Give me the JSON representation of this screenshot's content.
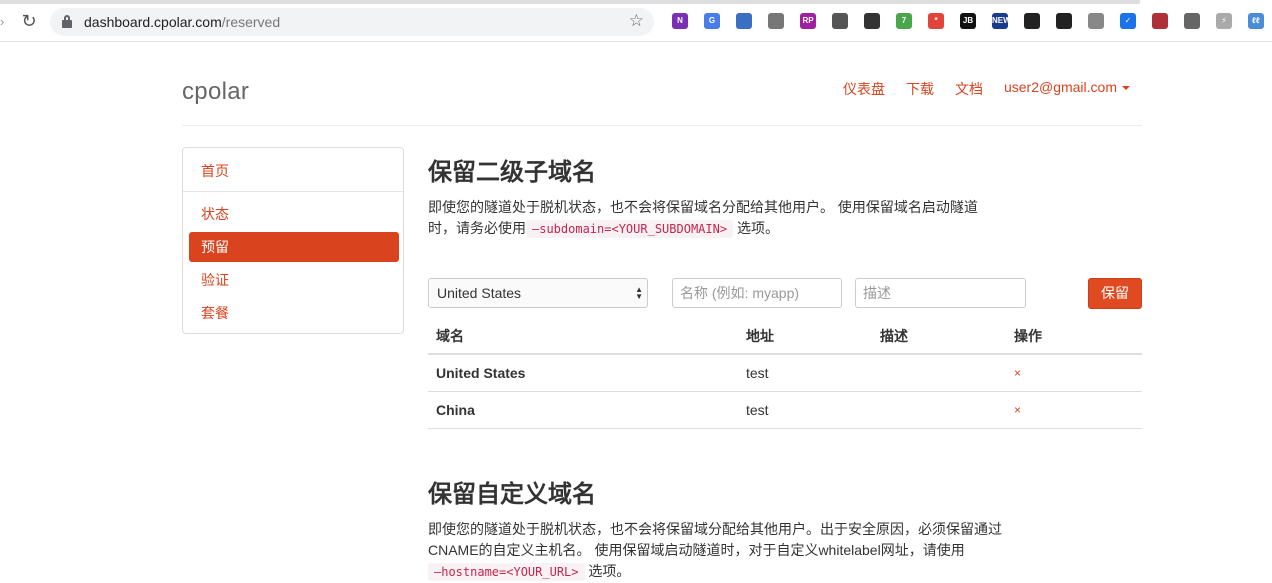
{
  "browser": {
    "url_host": "dashboard.cpolar.com",
    "url_path": "/reserved",
    "extensions": [
      {
        "icon": "onenote-icon",
        "color": "#7b2fb4",
        "label": "N"
      },
      {
        "icon": "translate-icon",
        "color": "#4a7de8",
        "label": "G"
      },
      {
        "icon": "globe-icon",
        "color": "#3a6fc4",
        "label": ""
      },
      {
        "icon": "window-icon",
        "color": "#777777",
        "label": ""
      },
      {
        "icon": "rp-icon",
        "color": "#a020a0",
        "label": "RP"
      },
      {
        "icon": "sync-icon",
        "color": "#555555",
        "label": ""
      },
      {
        "icon": "crane-icon",
        "color": "#333333",
        "label": ""
      },
      {
        "icon": "puzzle-icon",
        "color": "#4aa64a",
        "label": "7"
      },
      {
        "icon": "asterisk-icon",
        "color": "#e0443a",
        "label": "*"
      },
      {
        "icon": "jb-icon",
        "color": "#111111",
        "label": "JB"
      },
      {
        "icon": "new-icon",
        "color": "#1a3a8a",
        "label": "NEW"
      },
      {
        "icon": "qr-icon",
        "color": "#222222",
        "label": ""
      },
      {
        "icon": "qr-code-icon",
        "color": "#222222",
        "label": ""
      },
      {
        "icon": "shield-outline-icon",
        "color": "#888888",
        "label": ""
      },
      {
        "icon": "check-circle-icon",
        "color": "#1a73e8",
        "label": "✓"
      },
      {
        "icon": "pac-icon",
        "color": "#b0303a",
        "label": ""
      },
      {
        "icon": "shield-icon",
        "color": "#666666",
        "label": ""
      },
      {
        "icon": "bolt-icon",
        "color": "#aaaaaa",
        "label": "⚡"
      },
      {
        "icon": "ll-icon",
        "color": "#4a8cd8",
        "label": "ℓℓ"
      }
    ]
  },
  "header": {
    "logo": "cpolar",
    "nav": {
      "dashboard": "仪表盘",
      "download": "下载",
      "docs": "文档",
      "user": "user2@gmail.com"
    }
  },
  "sidebar": {
    "items": [
      {
        "label": "首页"
      },
      {
        "label": "状态"
      },
      {
        "label": "预留"
      },
      {
        "label": "验证"
      },
      {
        "label": "套餐"
      }
    ]
  },
  "section1": {
    "title": "保留二级子域名",
    "desc_line1": "即使您的隧道处于脱机状态，也不会将保留域名分配给其他用户。 使用保留域名启动隧道",
    "desc_line2_pre": "时，请务必使用",
    "desc_code": "—subdomain=<YOUR_SUBDOMAIN>",
    "desc_line2_post": "选项。",
    "form": {
      "region_value": "United States",
      "name_placeholder": "名称 (例如: myapp)",
      "desc_placeholder": "描述",
      "submit": "保留"
    },
    "table": {
      "headers": {
        "domain": "域名",
        "address": "地址",
        "desc": "描述",
        "action": "操作"
      },
      "rows": [
        {
          "domain": "United States",
          "address": "test",
          "desc": "",
          "action": "×"
        },
        {
          "domain": "China",
          "address": "test",
          "desc": "",
          "action": "×"
        }
      ]
    }
  },
  "section2": {
    "title": "保留自定义域名",
    "desc_line1": "即使您的隧道处于脱机状态，也不会将保留域分配给其他用户。出于安全原因，必须保留通过",
    "desc_line2": "CNAME的自定义主机名。 使用保留域启动隧道时，对于自定义whitelabel网址，请使用",
    "desc_code": "—hostname=<YOUR_URL>",
    "desc_line3_post": "选项。"
  }
}
